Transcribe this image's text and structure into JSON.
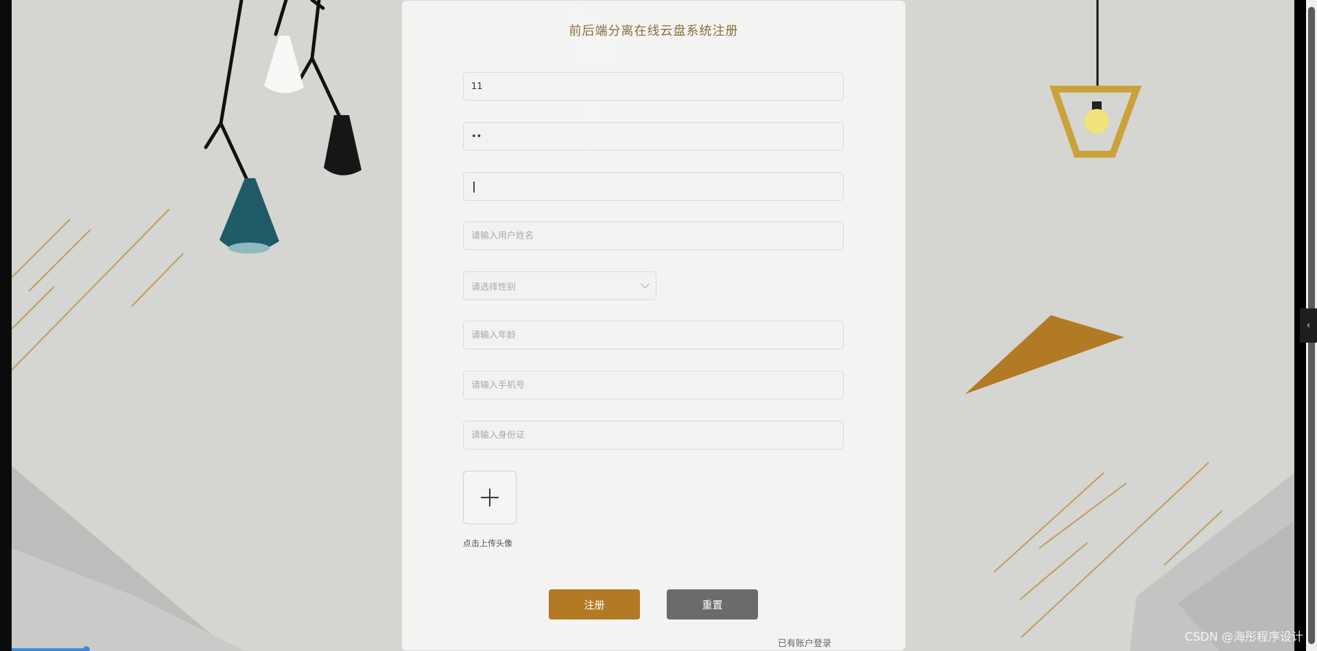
{
  "form": {
    "title": "前后端分离在线云盘系统注册",
    "username_value": "11",
    "password_value": "••",
    "confirm_password_value": "",
    "name_placeholder": "请输入用户姓名",
    "gender_placeholder": "请选择性别",
    "age_placeholder": "请输入年龄",
    "phone_placeholder": "请输入手机号",
    "idcard_placeholder": "请输入身份证",
    "upload_label": "点击上传头像",
    "register_label": "注册",
    "reset_label": "重置",
    "login_link": "已有账户登录"
  },
  "watermark": "CSDN @海彤程序设计",
  "colors": {
    "accent": "#b27a25",
    "title": "#8a6d3b",
    "reset": "#6b6b6b",
    "background": "#d5d5d1"
  },
  "icons": {
    "upload": "plus-icon",
    "select": "chevron-down-icon",
    "side_toggle": "chevron-left-icon"
  }
}
